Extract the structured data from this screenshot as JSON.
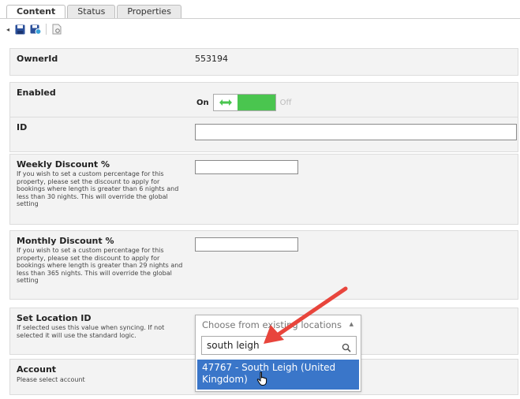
{
  "tabs": [
    "Content",
    "Status",
    "Properties"
  ],
  "toolbar": {
    "icons": [
      "save-icon",
      "save-and-publish-icon",
      "preview-icon"
    ]
  },
  "fields": {
    "owner": {
      "label": "OwnerId",
      "value": "553194"
    },
    "enabled": {
      "label": "Enabled",
      "on_label": "On",
      "off_label": "Off",
      "state": "on"
    },
    "id": {
      "label": "ID",
      "value": ""
    },
    "weekly": {
      "label": "Weekly Discount %",
      "description": "If you wish to set a custom percentage for this property, please set the discount to apply for bookings where length is greater than 6 nights and less than 30 nights. This will override the global setting",
      "value": ""
    },
    "monthly": {
      "label": "Monthly Discount %",
      "description": "If you wish to set a custom percentage for this property, please set the discount to apply for bookings where length is greater than 29 nights and less than 365 nights. This will override the global setting",
      "value": ""
    },
    "location": {
      "label": "Set Location ID",
      "description": "If selected uses this value when syncing. If not selected it will use the standard logic."
    },
    "account": {
      "label": "Account",
      "description": "Please select account"
    }
  },
  "dropdown": {
    "placeholder": "Choose from existing locations",
    "search_value": "south leigh",
    "option": "47767 - South Leigh (United Kingdom)"
  },
  "colors": {
    "toggle_on": "#4ac54f",
    "highlight": "#3a76c9",
    "annotation_arrow": "#e8453c"
  }
}
